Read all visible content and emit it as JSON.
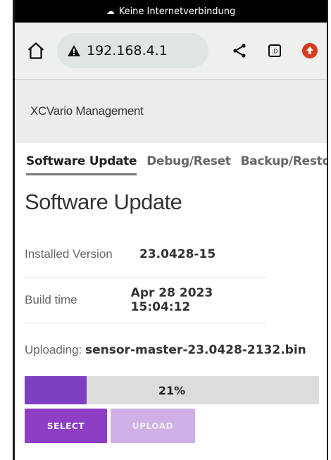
{
  "statusbar": {
    "text": "Keine Internetverbindung"
  },
  "browser": {
    "url": "192.168.4.1"
  },
  "site": {
    "title": "XCVario Management"
  },
  "tabs": [
    {
      "label": "Software Update",
      "active": true
    },
    {
      "label": "Debug/Reset",
      "active": false
    },
    {
      "label": "Backup/Restore",
      "active": false
    }
  ],
  "page": {
    "heading": "Software Update",
    "installed_label": "Installed Version",
    "installed_value": "23.0428-15",
    "build_label": "Build time",
    "build_value": "Apr 28 2023 15:04:12",
    "uploading_label": "Uploading:",
    "uploading_file": "sensor-master-23.0428-2132.bin"
  },
  "progress": {
    "percent": 21,
    "label": "21%"
  },
  "buttons": {
    "select": "SELECT",
    "upload": "UPLOAD"
  },
  "colors": {
    "accent": "#8e3dc5",
    "accent_disabled": "#d0aee6",
    "progress_fill": "#7e3fc2"
  }
}
